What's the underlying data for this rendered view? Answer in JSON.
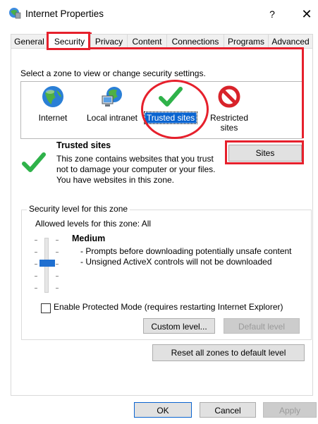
{
  "window": {
    "title": "Internet Properties",
    "help": "?",
    "close": "✕"
  },
  "tabs": [
    {
      "label": "General"
    },
    {
      "label": "Security"
    },
    {
      "label": "Privacy"
    },
    {
      "label": "Content"
    },
    {
      "label": "Connections"
    },
    {
      "label": "Programs"
    },
    {
      "label": "Advanced"
    }
  ],
  "security": {
    "zone_prompt": "Select a zone to view or change security settings.",
    "zones": [
      {
        "label": "Internet",
        "icon": "globe-icon"
      },
      {
        "label": "Local intranet",
        "icon": "intranet-icon"
      },
      {
        "label": "Trusted sites",
        "icon": "checkmark-icon"
      },
      {
        "label": "Restricted sites",
        "icon": "restricted-icon"
      }
    ],
    "selected_zone_title": "Trusted sites",
    "selected_zone_desc": "This zone contains websites that you trust not to damage your computer or your files.",
    "selected_zone_note": "You have websites in this zone.",
    "sites_button": "Sites",
    "level_group_title": "Security level for this zone",
    "allowed_levels": "Allowed levels for this zone: All",
    "level_name": "Medium",
    "level_items": [
      "- Prompts before downloading potentially unsafe content",
      "- Unsigned ActiveX controls will not be downloaded"
    ],
    "protected_mode_label": "Enable Protected Mode (requires restarting Internet Explorer)",
    "custom_level_button": "Custom level...",
    "default_level_button": "Default level",
    "reset_button": "Reset all zones to default level"
  },
  "footer": {
    "ok": "OK",
    "cancel": "Cancel",
    "apply": "Apply"
  },
  "colors": {
    "annotation": "#e6202c",
    "selection": "#0a64d0",
    "check": "#2fb24a"
  }
}
